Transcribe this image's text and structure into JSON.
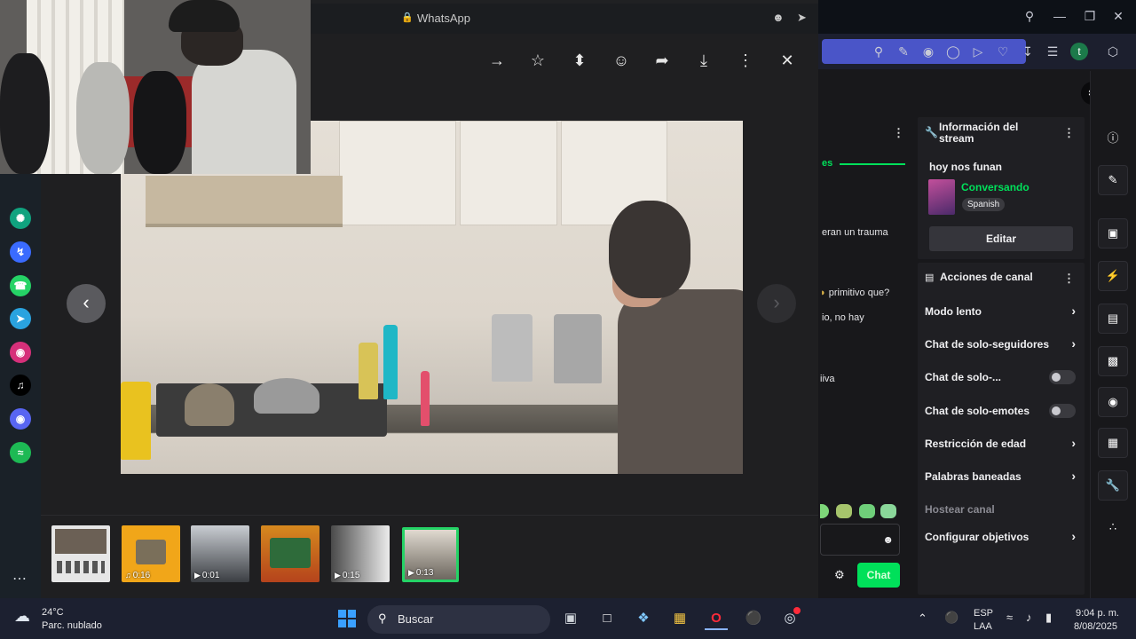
{
  "browser": {
    "window_controls": [
      "minimize",
      "restore",
      "close"
    ],
    "toolbar_profile_letter": "t"
  },
  "whatsapp": {
    "title": "WhatsApp",
    "thumbnails": [
      {
        "kind": "image",
        "duration": ""
      },
      {
        "kind": "audio",
        "duration": "0:16"
      },
      {
        "kind": "video",
        "duration": "0:01"
      },
      {
        "kind": "image",
        "duration": ""
      },
      {
        "kind": "video",
        "duration": "0:15"
      },
      {
        "kind": "video",
        "duration": "0:13",
        "selected": true
      }
    ]
  },
  "chat_fragments": {
    "header_fragment": "es",
    "line1": "eran un trauma",
    "line2": "primitivo que?",
    "line3": "io, no hay",
    "line4": "iiva",
    "send_button": "Chat"
  },
  "stream_info": {
    "title": "Información del stream",
    "stream_title": "hoy nos funan",
    "category": "Conversando",
    "language_tag": "Spanish",
    "edit_button": "Editar"
  },
  "channel_actions": {
    "title": "Acciones de canal",
    "items": [
      {
        "label": "Modo lento",
        "control": "chevron"
      },
      {
        "label": "Chat de solo-seguidores",
        "control": "chevron"
      },
      {
        "label": "Chat de solo-...",
        "control": "toggle"
      },
      {
        "label": "Chat de solo-emotes",
        "control": "toggle"
      },
      {
        "label": "Restricción de edad",
        "control": "chevron"
      },
      {
        "label": "Palabras baneadas",
        "control": "chevron"
      },
      {
        "label": "Hostear canal",
        "control": "none",
        "disabled": true
      },
      {
        "label": "Configurar objetivos",
        "control": "chevron"
      }
    ]
  },
  "taskbar": {
    "weather_temp": "24°C",
    "weather_desc": "Parc. nublado",
    "search_label": "Buscar",
    "lang_top": "ESP",
    "lang_bottom": "LAA",
    "time": "9:04 p. m.",
    "date": "8/08/2025"
  },
  "colors": {
    "twitch_green": "#00e05a",
    "whatsapp_green": "#25d366",
    "browser_toolbar": "#1c1f2e",
    "taskbar": "#1c2030"
  }
}
